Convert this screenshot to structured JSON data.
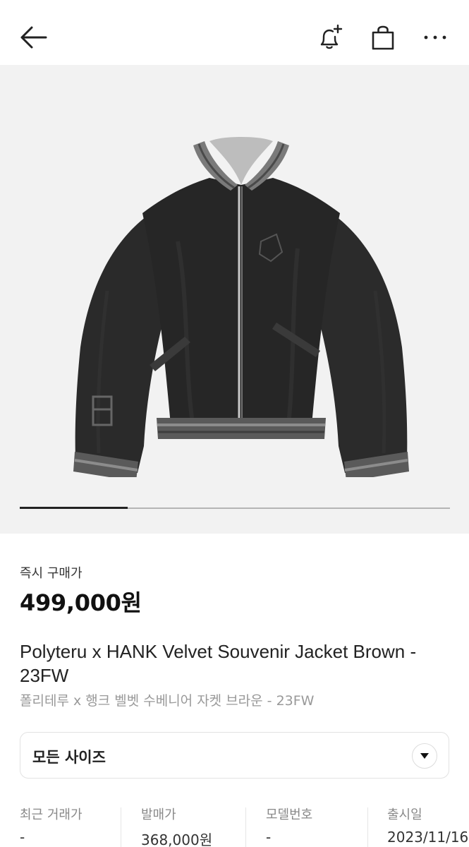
{
  "header": {
    "icons": [
      "back-arrow-icon",
      "bell-plus-icon",
      "shopping-bag-icon",
      "more-icon"
    ]
  },
  "gallery": {
    "image_subject": "black velvet souvenir jacket",
    "progress": 0.25
  },
  "price": {
    "label": "즉시 구매가",
    "value": "499,000원"
  },
  "product": {
    "title": "Polyteru x HANK Velvet Souvenir Jacket Brown - 23FW",
    "subtitle": "폴리테루 x 행크 벨벳 수베니어 자켓 브라운 - 23FW"
  },
  "size_select": {
    "label": "모든 사이즈"
  },
  "info": [
    {
      "label": "최근 거래가",
      "value": "-"
    },
    {
      "label": "발매가",
      "value": "368,000원"
    },
    {
      "label": "모델번호",
      "value": "-"
    },
    {
      "label": "출시일",
      "value": "2023/11/16"
    }
  ],
  "colors": {
    "text": "#222222",
    "muted": "#999999",
    "gallery_bg": "#f2f2f2",
    "jacket": "#262626",
    "rib_gray": "#7a7a7a"
  }
}
